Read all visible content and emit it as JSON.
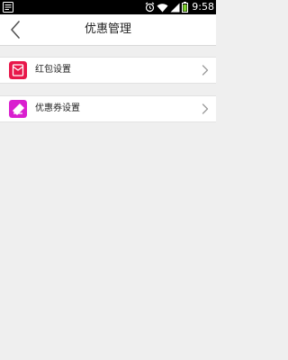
{
  "status_bar": {
    "time": "9:58",
    "icons": [
      "notification-icon",
      "alarm-icon",
      "wifi-icon",
      "signal-icon",
      "battery-icon"
    ]
  },
  "header": {
    "title": "优惠管理",
    "back_icon": "back-arrow-icon"
  },
  "menu": {
    "items": [
      {
        "label": "红包设置",
        "icon": "red-packet-icon",
        "icon_color": "#e8174a"
      },
      {
        "label": "优惠券设置",
        "icon": "coupon-icon",
        "icon_color": "#d91fcf"
      }
    ]
  },
  "colors": {
    "background": "#efefef",
    "row_background": "#ffffff",
    "status_bar": "#000000"
  }
}
